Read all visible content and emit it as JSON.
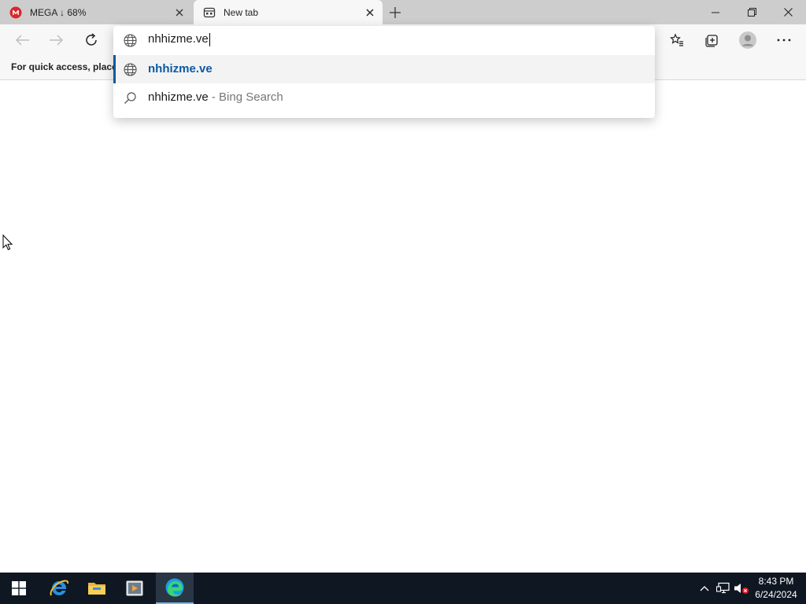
{
  "tabs": [
    {
      "title": "MEGA ↓ 68%",
      "favicon": "mega-icon",
      "active": false
    },
    {
      "title": "New tab",
      "favicon": "new-tab-page-icon",
      "active": true
    }
  ],
  "favorites_bar": {
    "text": "For quick access, place y"
  },
  "omnibox": {
    "value": "nhhizme.ve",
    "suggestions": [
      {
        "text": "nhhizme.ve",
        "icon": "globe-icon",
        "type": "url"
      },
      {
        "text": "nhhizme.ve",
        "suffix": " - Bing Search",
        "icon": "search-icon",
        "type": "search"
      }
    ]
  },
  "taskbar": {
    "time": "8:43 PM",
    "date": "6/24/2024"
  },
  "colors": {
    "accent": "#0c59a4",
    "tabbar": "#cdcdcd",
    "taskbar": "#0f1722",
    "mega": "#d9272e"
  }
}
